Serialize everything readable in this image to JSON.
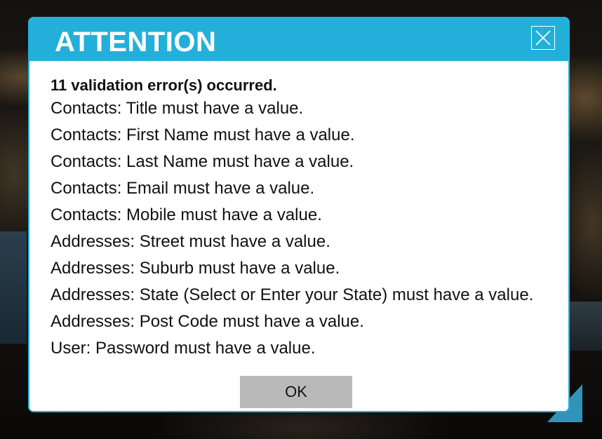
{
  "dialog": {
    "title": "ATTENTION",
    "close_icon": "close-icon",
    "summary": "11 validation error(s) occurred.",
    "errors": [
      "Contacts: Title must have a value.",
      "Contacts: First Name must have a value.",
      "Contacts: Last Name must have a value.",
      "Contacts: Email must have a value.",
      "Contacts: Mobile must have a value.",
      "Addresses: Street must have a value.",
      "Addresses: Suburb must have a value.",
      "Addresses: State (Select or Enter your State) must have a value.",
      "Addresses: Post Code must have a value.",
      "User: Password must have a value."
    ],
    "ok_label": "OK"
  },
  "colors": {
    "header": "#22b0da",
    "ok_button": "#b9b9b9",
    "backdrop": "#14110e"
  }
}
